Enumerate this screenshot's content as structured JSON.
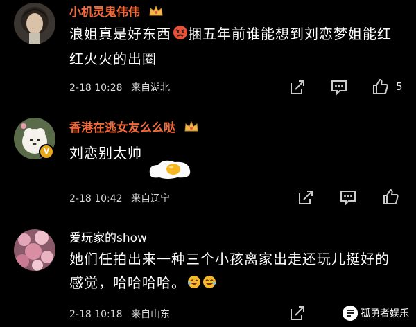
{
  "comments": [
    {
      "username": "小机灵鬼伟伟",
      "text_before_emoji": "浪姐真是好东西",
      "text_after_emoji": "捆五年前谁能想到刘恋梦姐能红红火火的出圈",
      "date": "2-18 10:28",
      "location": "来自湖北",
      "likes": "5",
      "username_color": "#f2693a"
    },
    {
      "username": "香港在逃女友么么哒",
      "text": "刘恋别太帅",
      "date": "2-18 10:42",
      "location": "来自辽宁",
      "username_color": "#f2693a"
    },
    {
      "username": "爱玩家的show",
      "text": "她们任拍出来一种三个小孩离家出走还玩儿挺好的感觉，哈哈哈哈。",
      "date": "2-18 10:18",
      "location": "来自山东",
      "username_color": "#ffffff"
    }
  ],
  "watermark": {
    "text": "孤勇者娱乐"
  },
  "icons": {
    "share": "share-icon",
    "comment": "comment-icon",
    "like": "thumbs-up-icon",
    "crown": "crown-icon",
    "verified": "verified-badge-icon"
  }
}
